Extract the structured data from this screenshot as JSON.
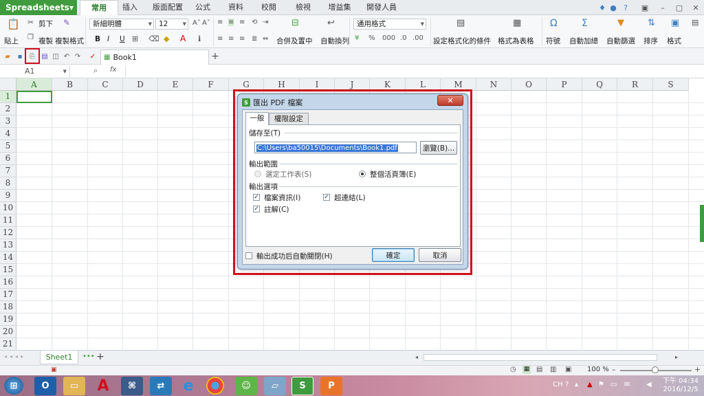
{
  "app": {
    "name": "Spreadsheets",
    "document_tab": "Book1"
  },
  "ribbon_tabs": [
    "常用",
    "插入",
    "版面配置",
    "公式",
    "資料",
    "校閱",
    "檢視",
    "增益集",
    "開發人員"
  ],
  "ribbon": {
    "paste": "貼上",
    "cut": "剪下",
    "copy": "複製",
    "format_painter": "複製格式",
    "font_name": "新細明體",
    "font_size": "12",
    "merge_center": "合併及置中",
    "wrap_text": "自動換列",
    "number_format": "通用格式",
    "conditional_format": "設定格式化的條件",
    "format_as_table": "格式為表格",
    "symbol": "符號",
    "autosum": "自動加總",
    "autofilter": "自動篩選",
    "sort": "排序",
    "format": "格式",
    "bold": "B",
    "italic": "I",
    "underline": "U"
  },
  "formula_bar": {
    "name_box": "A1",
    "fx": "fx"
  },
  "grid": {
    "columns": [
      "A",
      "B",
      "C",
      "D",
      "E",
      "F",
      "G",
      "H",
      "I",
      "J",
      "K",
      "L",
      "M",
      "N",
      "O",
      "P",
      "Q",
      "R",
      "S"
    ],
    "rows": [
      "1",
      "2",
      "3",
      "4",
      "5",
      "6",
      "7",
      "8",
      "9",
      "10",
      "11",
      "12",
      "13",
      "14",
      "15",
      "16",
      "17",
      "18",
      "19",
      "20",
      "21"
    ]
  },
  "sheet": {
    "tab": "Sheet1",
    "zoom": "100 %"
  },
  "dialog": {
    "title": "匯出 PDF 檔案",
    "close": "✕",
    "tabs": [
      "一般",
      "權限設定"
    ],
    "save_to_label": "儲存至(T)",
    "path": "C:\\Users\\ba50015\\Documents\\Book1.pdf",
    "browse": "瀏覽(B)...",
    "range_label": "輸出範圍",
    "range_selected_sheet": "選定工作表(S)",
    "range_whole_workbook": "整個活頁簿(E)",
    "options_label": "輸出選項",
    "opt_doc_info": "檔案資訊(I)",
    "opt_hyperlinks": "超連結(L)",
    "opt_comments": "註解(C)",
    "auto_close": "輸出成功后自動關閉(H)",
    "ok": "確定",
    "cancel": "取消"
  },
  "taskbar": {
    "input_method": "CH",
    "time": "下午 04:34",
    "date": "2016/12/5"
  },
  "colors": {
    "brand_green": "#3f9b3d",
    "highlight_red": "#d0101c"
  }
}
